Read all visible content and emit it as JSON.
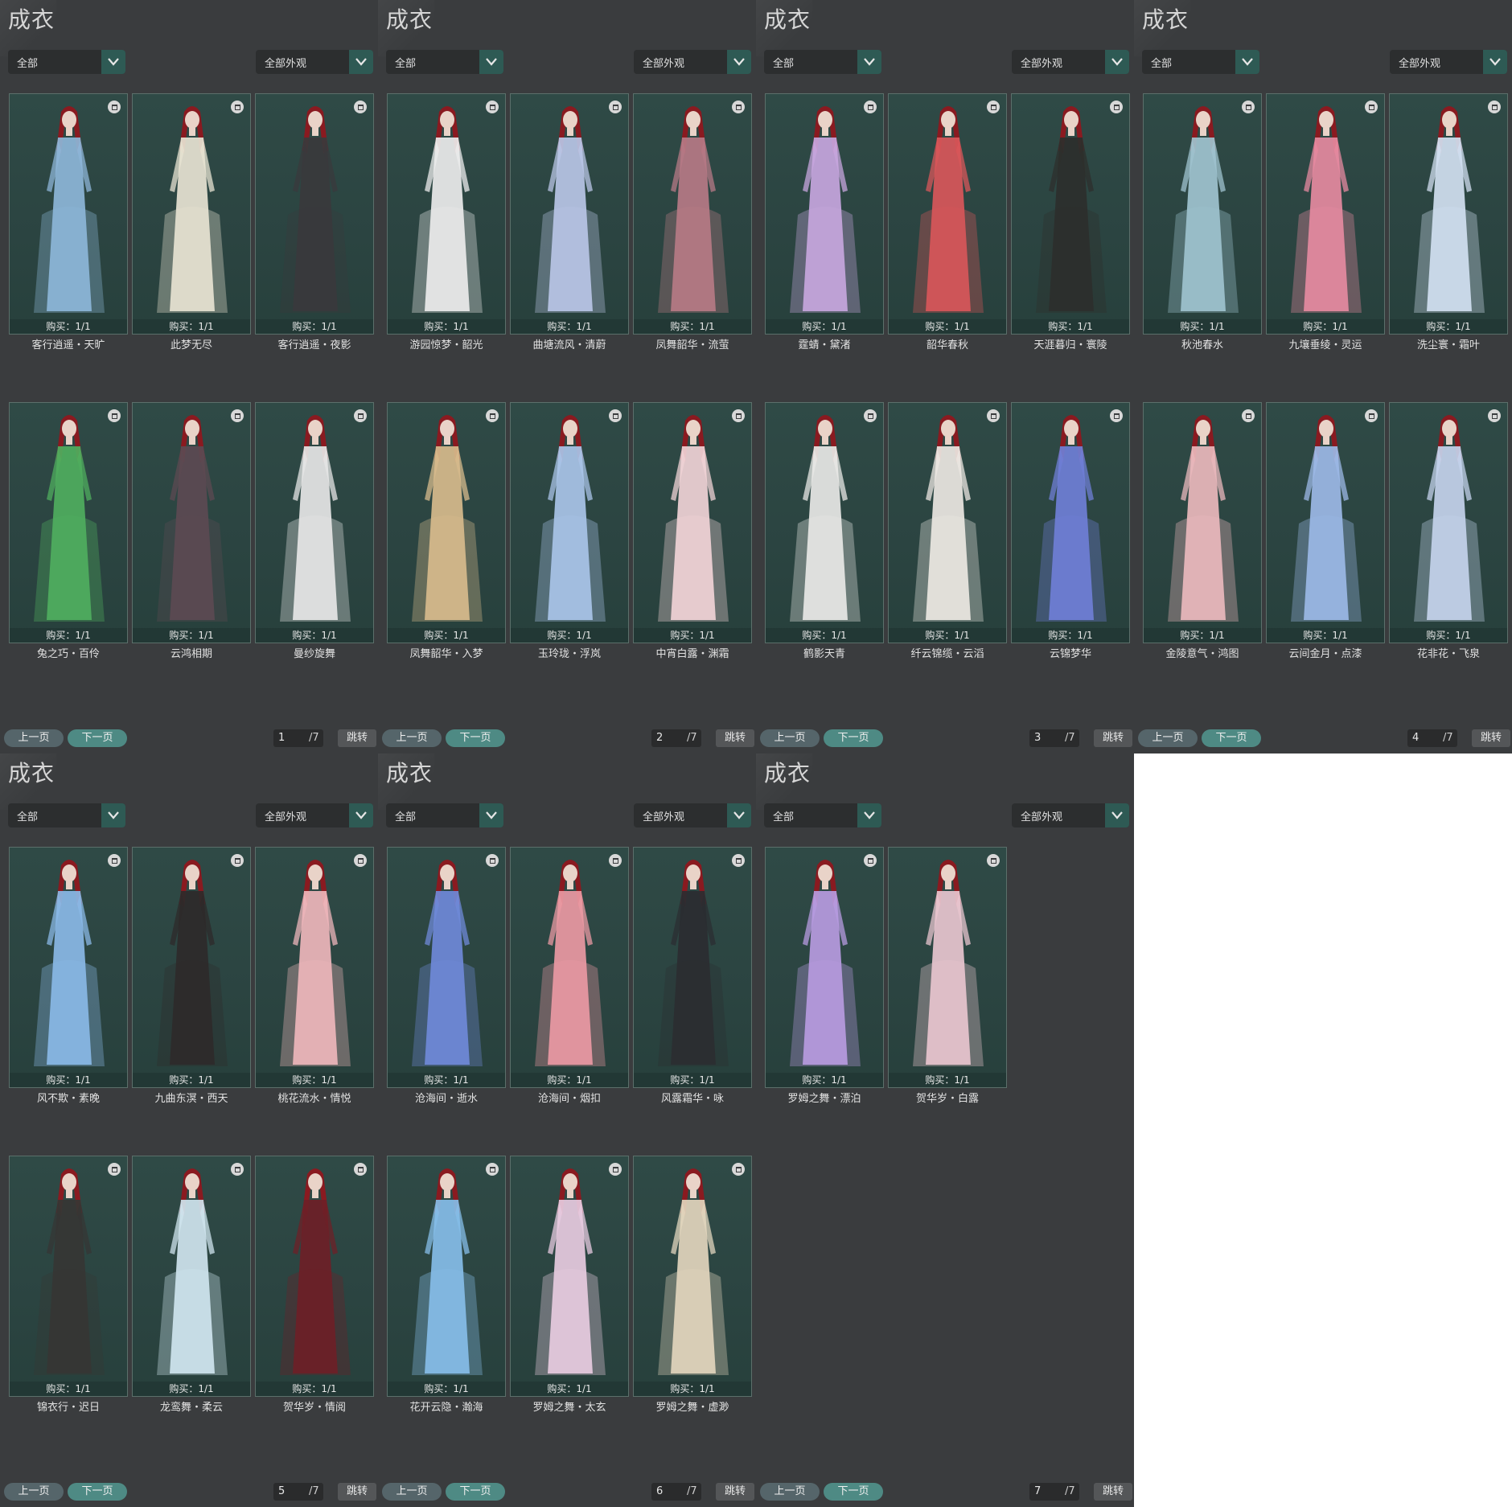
{
  "panels": [
    {
      "title": "成衣",
      "filter_left": "全部",
      "filter_right": "全部外观",
      "prev": "上一页",
      "next": "下一页",
      "page": "1",
      "total": "/7",
      "jump": "跳转",
      "items": [
        {
          "name": "客行逍遥・天旷",
          "buy": "购买：1/1",
          "color": "#8db6d8"
        },
        {
          "name": "此梦无尽",
          "buy": "购买：1/1",
          "color": "#e7e3d2"
        },
        {
          "name": "客行逍遥・夜影",
          "buy": "购买：1/1",
          "color": "#3a3a3c"
        },
        {
          "name": "兔之巧・百伶",
          "buy": "购买：1/1",
          "color": "#4fae5e"
        },
        {
          "name": "云鸿相期",
          "buy": "购买：1/1",
          "color": "#5c4a52"
        },
        {
          "name": "曼纱旋舞",
          "buy": "购买：1/1",
          "color": "#e6e6e6"
        }
      ]
    },
    {
      "title": "成衣",
      "filter_left": "全部",
      "filter_right": "全部外观",
      "prev": "上一页",
      "next": "下一页",
      "page": "2",
      "total": "/7",
      "jump": "跳转",
      "items": [
        {
          "name": "游园惊梦・韶光",
          "buy": "购买：1/1",
          "color": "#ececec"
        },
        {
          "name": "曲塘流风・清蔚",
          "buy": "购买：1/1",
          "color": "#b9c5e6"
        },
        {
          "name": "凤舞韶华・流萤",
          "buy": "购买：1/1",
          "color": "#b67a85"
        },
        {
          "name": "凤舞韶华・入梦",
          "buy": "购买：1/1",
          "color": "#d7bb8c"
        },
        {
          "name": "玉玲珑・浮岚",
          "buy": "购买：1/1",
          "color": "#a9c4e8"
        },
        {
          "name": "中宵白露・渊霜",
          "buy": "购买：1/1",
          "color": "#f0d3d6"
        }
      ]
    },
    {
      "title": "成衣",
      "filter_left": "全部",
      "filter_right": "全部外观",
      "prev": "上一页",
      "next": "下一页",
      "page": "3",
      "total": "/7",
      "jump": "跳转",
      "items": [
        {
          "name": "霆蜻・黛渚",
          "buy": "购买：1/1",
          "color": "#c7a6de"
        },
        {
          "name": "韶华春秋",
          "buy": "购买：1/1",
          "color": "#d8575a"
        },
        {
          "name": "天涯暮归・寰陵",
          "buy": "购买：1/1",
          "color": "#2d2f2c"
        },
        {
          "name": "鹤影天青",
          "buy": "购买：1/1",
          "color": "#e8e8e6"
        },
        {
          "name": "纤云锦缆・云滔",
          "buy": "购买：1/1",
          "color": "#ece7e2"
        },
        {
          "name": "云锦梦华",
          "buy": "购买：1/1",
          "color": "#6f7fd6"
        }
      ]
    },
    {
      "title": "成衣",
      "filter_left": "全部",
      "filter_right": "全部外观",
      "prev": "上一页",
      "next": "下一页",
      "page": "4",
      "total": "/7",
      "jump": "跳转",
      "items": [
        {
          "name": "秋池春水",
          "buy": "购买：1/1",
          "color": "#9fc3cf"
        },
        {
          "name": "九壤垂绫・灵运",
          "buy": "购买：1/1",
          "color": "#e58aa0"
        },
        {
          "name": "洗尘寰・霜叶",
          "buy": "购买：1/1",
          "color": "#d1dff0"
        },
        {
          "name": "金陵意气・鸿图",
          "buy": "购买：1/1",
          "color": "#eab8bc"
        },
        {
          "name": "云间金月・点漆",
          "buy": "购买：1/1",
          "color": "#9cb8e6"
        },
        {
          "name": "花非花・飞泉",
          "buy": "购买：1/1",
          "color": "#c4d3ec"
        }
      ]
    },
    {
      "title": "成衣",
      "filter_left": "全部",
      "filter_right": "全部外观",
      "prev": "上一页",
      "next": "下一页",
      "page": "5",
      "total": "/7",
      "jump": "跳转",
      "items": [
        {
          "name": "风不欺・素晚",
          "buy": "购买：1/1",
          "color": "#8ab8e6"
        },
        {
          "name": "九曲东溟・西天",
          "buy": "购买：1/1",
          "color": "#2e2a2a"
        },
        {
          "name": "桃花流水・情悦",
          "buy": "购买：1/1",
          "color": "#eeb6bb"
        },
        {
          "name": "锦衣行・迟日",
          "buy": "购买：1/1",
          "color": "#363634"
        },
        {
          "name": "龙鸾舞・柔云",
          "buy": "购买：1/1",
          "color": "#cfe4ee"
        },
        {
          "name": "贺华岁・情阅",
          "buy": "购买：1/1",
          "color": "#6e2027"
        }
      ]
    },
    {
      "title": "成衣",
      "filter_left": "全部",
      "filter_right": "全部外观",
      "prev": "上一页",
      "next": "下一页",
      "page": "6",
      "total": "/7",
      "jump": "跳转",
      "items": [
        {
          "name": "沧海间・逝水",
          "buy": "购买：1/1",
          "color": "#6f89d8"
        },
        {
          "name": "沧海间・烟扣",
          "buy": "购买：1/1",
          "color": "#ea99a3"
        },
        {
          "name": "风露霜华・咏",
          "buy": "购买：1/1",
          "color": "#2b2d31"
        },
        {
          "name": "花开云隐・瀚海",
          "buy": "购买：1/1",
          "color": "#86bde8"
        },
        {
          "name": "罗姆之舞・太玄",
          "buy": "购买：1/1",
          "color": "#e7cbe0"
        },
        {
          "name": "罗姆之舞・虚渺",
          "buy": "购买：1/1",
          "color": "#e2d5bd"
        }
      ]
    },
    {
      "title": "成衣",
      "filter_left": "全部",
      "filter_right": "全部外观",
      "prev": "上一页",
      "next": "下一页",
      "page": "7",
      "total": "/7",
      "jump": "跳转",
      "items": [
        {
          "name": "罗姆之舞・漂泊",
          "buy": "购买：1/1",
          "color": "#b79be0"
        },
        {
          "name": "贺华岁・白露",
          "buy": "购买：1/1",
          "color": "#e8c6cf"
        }
      ]
    }
  ],
  "colors": {
    "hair": "#8a1a20",
    "skin": "#e9d3c8",
    "arrow": "#e6e6e6"
  }
}
